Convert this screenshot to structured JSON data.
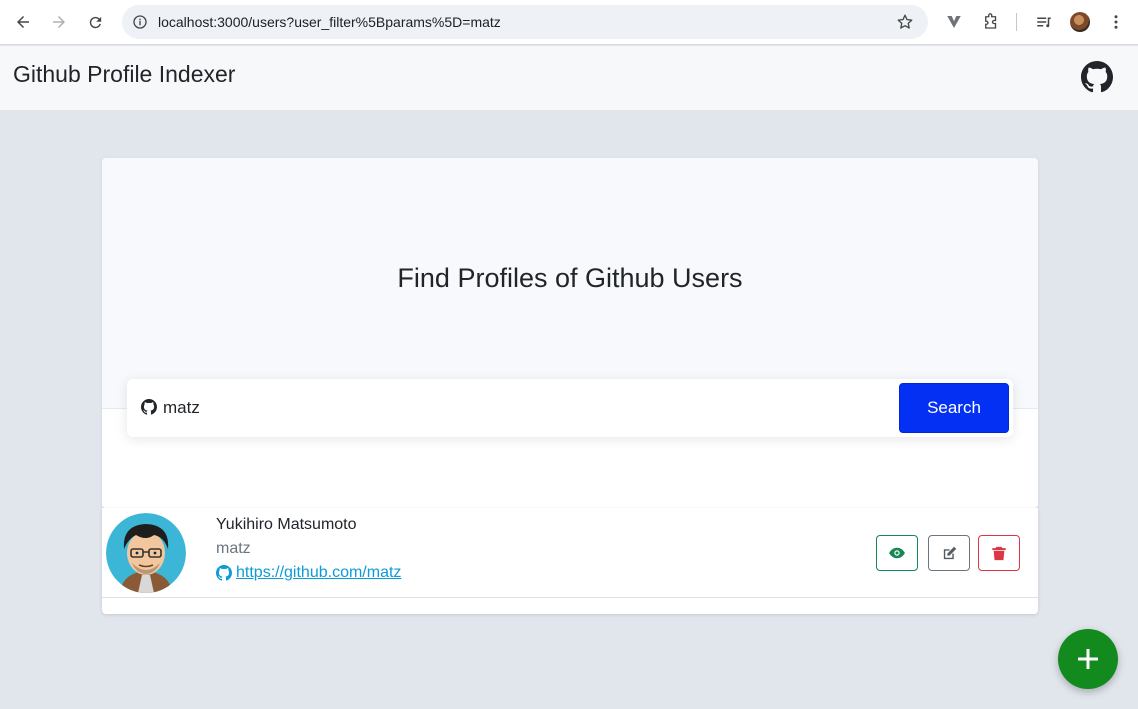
{
  "browser": {
    "url": "localhost:3000/users?user_filter%5Bparams%5D=matz",
    "icons": [
      "back-icon",
      "forward-icon",
      "reload-icon",
      "site-info-icon",
      "bookmark-star-icon",
      "extension-v-icon",
      "extensions-puzzle-icon",
      "reading-list-icon",
      "profile-avatar-icon",
      "kebab-menu-icon"
    ]
  },
  "header": {
    "title": "Github Profile Indexer",
    "logo_icon": "github-icon"
  },
  "hero": {
    "title": "Find Profiles of Github Users"
  },
  "search": {
    "value": "matz",
    "button_label": "Search",
    "icon": "github-icon"
  },
  "results": [
    {
      "name": "Yukihiro Matsumoto",
      "login": "matz",
      "link": "https://github.com/matz",
      "actions": [
        "view-eye-icon",
        "edit-icon",
        "delete-trash-icon"
      ]
    }
  ],
  "fab": {
    "icon": "plus-icon"
  },
  "colors": {
    "primary": "#0330f2",
    "success": "#198754",
    "danger": "#dc3545",
    "fab": "#138a1e",
    "link": "#0d9bd6"
  }
}
